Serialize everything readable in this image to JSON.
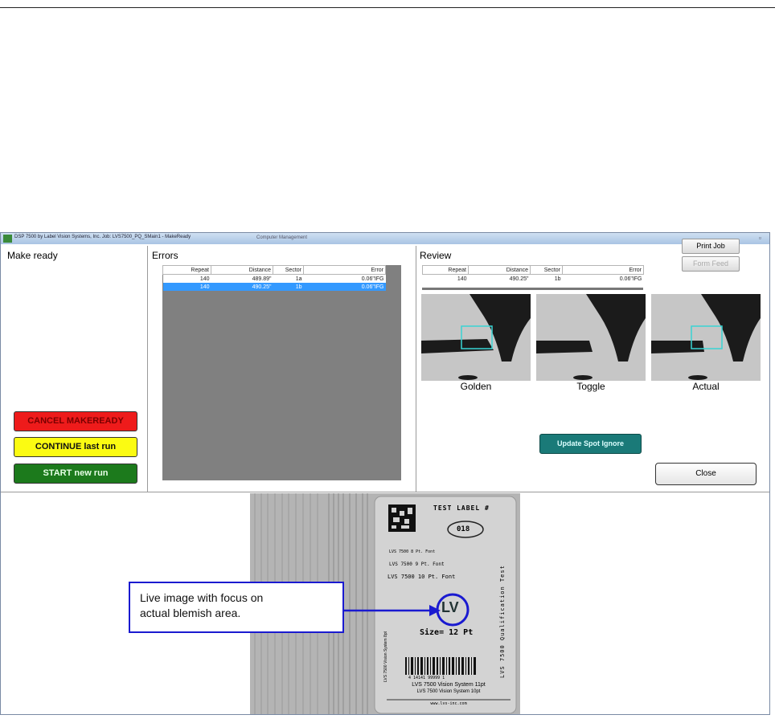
{
  "window": {
    "title": "DSP 7500 by Label Vision Systems, Inc.   Job: LVS7500_PQ_SMain1 - MakeReady",
    "background_tab": "Computer Management"
  },
  "make_ready": {
    "title": "Make ready",
    "cancel_label": "CANCEL MAKEREADY",
    "continue_label": "CONTINUE last run",
    "start_label": "START new run"
  },
  "errors": {
    "title": "Errors",
    "columns": [
      "Repeat",
      "Distance",
      "Sector",
      "Error"
    ],
    "rows": [
      {
        "repeat": "140",
        "distance": "489.89\"",
        "sector": "1a",
        "error": "0.06\"IFG"
      },
      {
        "repeat": "140",
        "distance": "490.25\"",
        "sector": "1b",
        "error": "0.06\"IFG"
      }
    ],
    "selected_row": 1
  },
  "review": {
    "title": "Review",
    "columns": [
      "Repeat",
      "Distance",
      "Sector",
      "Error"
    ],
    "row": {
      "repeat": "140",
      "distance": "490.25\"",
      "sector": "1b",
      "error": "0.06\"IFG"
    },
    "images": [
      {
        "caption": "Golden"
      },
      {
        "caption": "Toggle"
      },
      {
        "caption": "Actual"
      }
    ],
    "update_spot_label": "Update Spot Ignore",
    "close_label": "Close"
  },
  "toolbar": {
    "print_job_label": "Print Job",
    "form_feed_label": "Form Feed"
  },
  "live_image": {
    "label": {
      "title": "TEST LABEL #",
      "number": "018",
      "lines": [
        "LVS 7500 8 Pt. Font",
        "LVS 7500 9 Pt. Font",
        "LVS 7500 10 Pt. Font"
      ],
      "size_text": "Size= 12 Pt",
      "vertical_right": "LVS 7500 Qualification Test",
      "vertical_left": "LVS 7500 Vision System 8pt",
      "barcode_number": "4 14141 99999 1",
      "footer_lines": [
        "LVS 7500 Vision System 11pt",
        "LVS 7500 Vision System 10pt"
      ],
      "url": "www.lvs-inc.com",
      "logo": "LV"
    },
    "callout_line1": "Live image with focus on",
    "callout_line2": "actual blemish area."
  },
  "colors": {
    "cancel": "#ee1b1b",
    "continue": "#fbfb12",
    "start": "#1c7a1c",
    "selection": "#3399ff",
    "teal_button": "#1a7a78",
    "callout_border": "#1a1ad0"
  }
}
